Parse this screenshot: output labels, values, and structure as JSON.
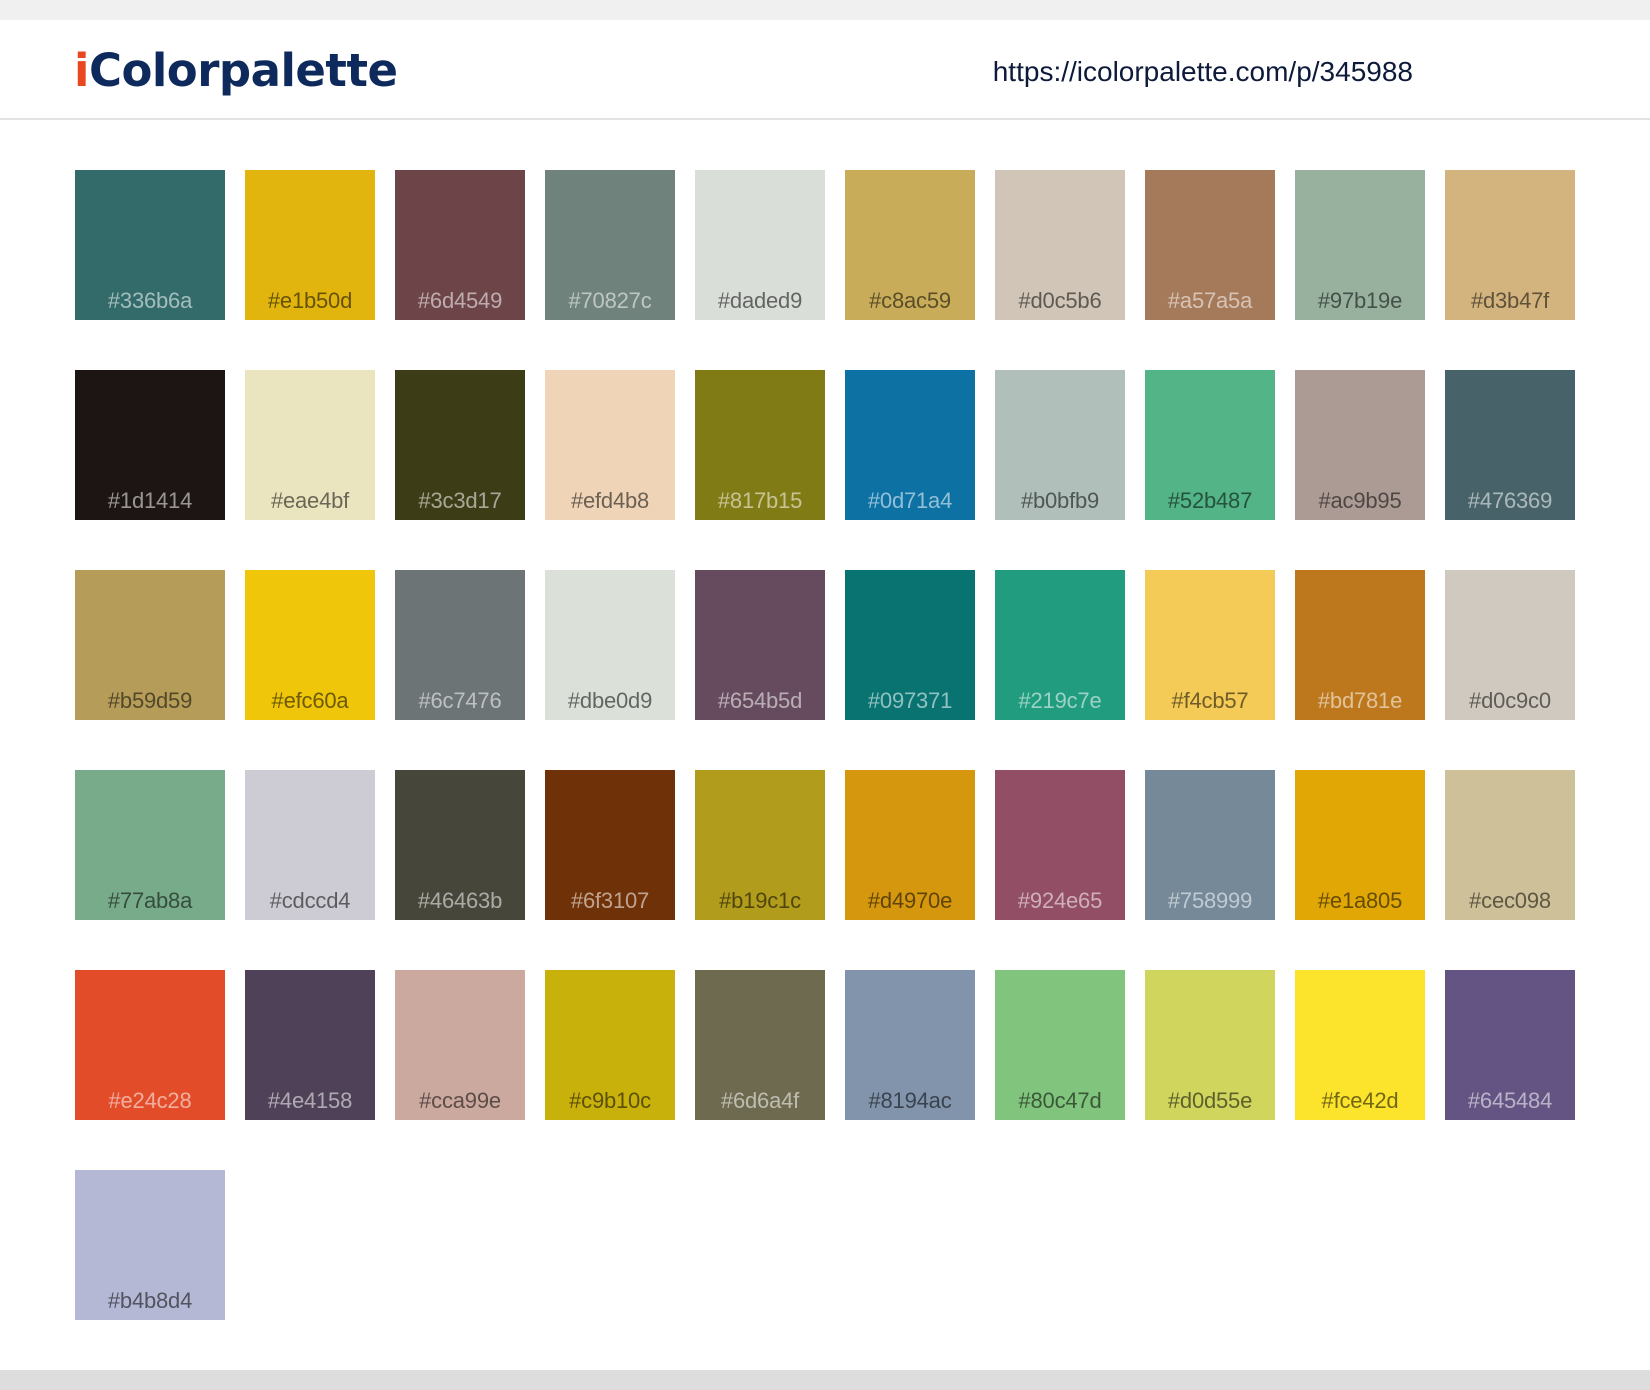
{
  "header": {
    "logo_i": "i",
    "logo_rest": "Colorpalette",
    "url": "https://icolorpalette.com/p/345988"
  },
  "palette": [
    "#336b6a",
    "#e1b50d",
    "#6d4549",
    "#70827c",
    "#daded9",
    "#c8ac59",
    "#d0c5b6",
    "#a57a5a",
    "#97b19e",
    "#d3b47f",
    "#1d1414",
    "#eae4bf",
    "#3c3d17",
    "#efd4b8",
    "#817b15",
    "#0d71a4",
    "#b0bfb9",
    "#52b487",
    "#ac9b95",
    "#476369",
    "#b59d59",
    "#efc60a",
    "#6c7476",
    "#dbe0d9",
    "#654b5d",
    "#097371",
    "#219c7e",
    "#f4cb57",
    "#bd781e",
    "#d0c9c0",
    "#77ab8a",
    "#cdccd4",
    "#46463b",
    "#6f3107",
    "#b19c1c",
    "#d4970e",
    "#924e65",
    "#758999",
    "#e1a805",
    "#cec098",
    "#e24c28",
    "#4e4158",
    "#cca99e",
    "#c9b10c",
    "#6d6a4f",
    "#8194ac",
    "#80c47d",
    "#d0d55e",
    "#fce42d",
    "#645484",
    "#b4b8d4"
  ]
}
